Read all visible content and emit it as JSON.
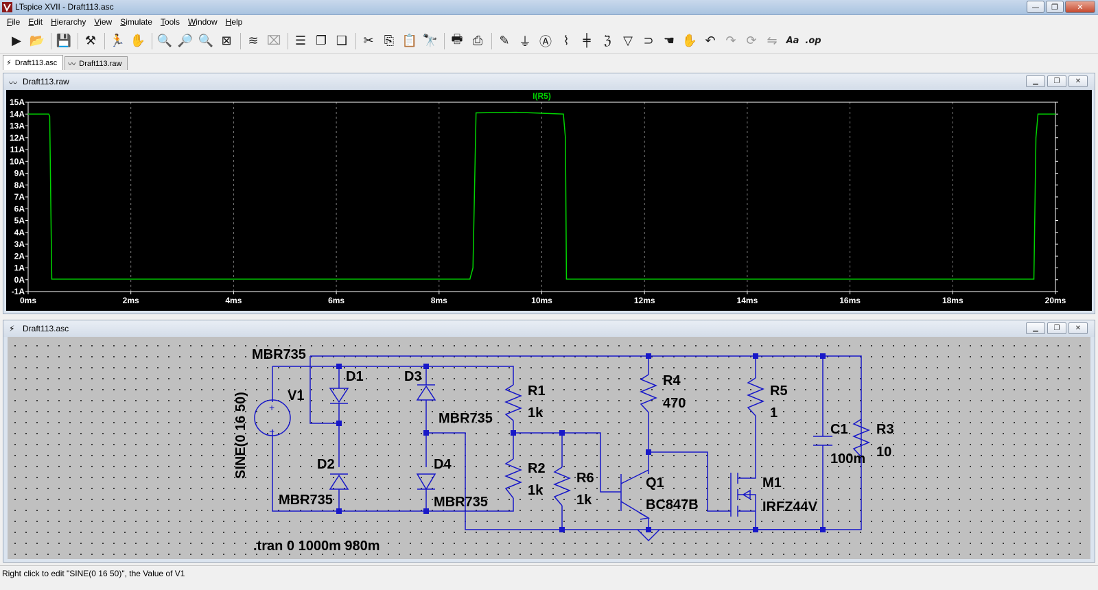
{
  "window": {
    "title": "LTspice XVII - Draft113.asc"
  },
  "menu": [
    {
      "label": "File",
      "accel": "F",
      "rest": "ile"
    },
    {
      "label": "Edit",
      "accel": "E",
      "rest": "dit"
    },
    {
      "label": "Hierarchy",
      "accel": "H",
      "rest": "ierarchy"
    },
    {
      "label": "View",
      "accel": "V",
      "rest": "iew"
    },
    {
      "label": "Simulate",
      "accel": "S",
      "rest": "imulate"
    },
    {
      "label": "Tools",
      "accel": "T",
      "rest": "ools"
    },
    {
      "label": "Window",
      "accel": "W",
      "rest": "indow"
    },
    {
      "label": "Help",
      "accel": "H",
      "rest": "elp"
    }
  ],
  "toolbar": [
    {
      "name": "run-icon",
      "glyph": "▶",
      "enabled": true
    },
    {
      "name": "open-icon",
      "glyph": "📂",
      "enabled": true
    },
    {
      "sep": true
    },
    {
      "name": "save-icon",
      "glyph": "💾",
      "enabled": true
    },
    {
      "sep": true
    },
    {
      "name": "control-panel-icon",
      "glyph": "⚒",
      "enabled": true
    },
    {
      "sep": true
    },
    {
      "name": "halt-icon",
      "glyph": "🏃",
      "enabled": true
    },
    {
      "name": "pan-icon",
      "glyph": "✋",
      "enabled": false
    },
    {
      "sep": true
    },
    {
      "name": "zoom-in-icon",
      "glyph": "🔍",
      "enabled": true
    },
    {
      "name": "zoom-area-icon",
      "glyph": "🔎",
      "enabled": false
    },
    {
      "name": "zoom-out-icon",
      "glyph": "🔍",
      "enabled": true
    },
    {
      "name": "zoom-fit-icon",
      "glyph": "⊠",
      "enabled": true
    },
    {
      "sep": true
    },
    {
      "name": "autoscale-icon",
      "glyph": "≋",
      "enabled": true
    },
    {
      "name": "delete-trace-icon",
      "glyph": "⌧",
      "enabled": false
    },
    {
      "sep": true
    },
    {
      "name": "tile-horizontal-icon",
      "glyph": "☰",
      "enabled": true
    },
    {
      "name": "cascade-icon",
      "glyph": "❐",
      "enabled": true
    },
    {
      "name": "tile-vertical-icon",
      "glyph": "❑",
      "enabled": true
    },
    {
      "sep": true
    },
    {
      "name": "cut-icon",
      "glyph": "✂",
      "enabled": true
    },
    {
      "name": "copy-icon",
      "glyph": "⎘",
      "enabled": true
    },
    {
      "name": "paste-icon",
      "glyph": "📋",
      "enabled": false
    },
    {
      "name": "find-icon",
      "glyph": "🔭",
      "enabled": true
    },
    {
      "sep": true
    },
    {
      "name": "print-preview-icon",
      "glyph": "🖶",
      "enabled": true
    },
    {
      "name": "print-icon",
      "glyph": "⎙",
      "enabled": true
    },
    {
      "sep": true
    },
    {
      "name": "draw-wire-icon",
      "glyph": "✎",
      "enabled": true
    },
    {
      "name": "ground-icon",
      "glyph": "⏚",
      "enabled": true
    },
    {
      "name": "label-net-icon",
      "glyph": "Ⓐ",
      "enabled": true
    },
    {
      "name": "resistor-icon",
      "glyph": "⌇",
      "enabled": true
    },
    {
      "name": "capacitor-icon",
      "glyph": "╪",
      "enabled": true
    },
    {
      "name": "inductor-icon",
      "glyph": "ℨ",
      "enabled": true
    },
    {
      "name": "diode-icon",
      "glyph": "▽",
      "enabled": true
    },
    {
      "name": "component-icon",
      "glyph": "⊃",
      "enabled": true
    },
    {
      "name": "move-icon",
      "glyph": "☚",
      "enabled": true
    },
    {
      "name": "drag-icon",
      "glyph": "✋",
      "enabled": true
    },
    {
      "name": "undo-icon",
      "glyph": "↶",
      "enabled": true
    },
    {
      "name": "redo-icon",
      "glyph": "↷",
      "enabled": false
    },
    {
      "name": "rotate-icon",
      "glyph": "⟳",
      "enabled": false
    },
    {
      "name": "mirror-icon",
      "glyph": "⇋",
      "enabled": false
    },
    {
      "name": "text-icon",
      "glyph": "Aa",
      "enabled": true
    },
    {
      "name": "spice-directive-icon",
      "glyph": ".op",
      "enabled": true
    }
  ],
  "tabs": [
    {
      "label": "Draft113.asc",
      "icon": "⚡",
      "active": true
    },
    {
      "label": "Draft113.raw",
      "icon": "〰",
      "active": false
    }
  ],
  "waveform": {
    "title": "Draft113.raw",
    "trace_name": "I(R5)",
    "colors": {
      "trace": "#00d400",
      "grid": "#7a7a7a",
      "axis": "#ffffff",
      "label": "#ffffff"
    }
  },
  "chart_data": {
    "type": "line",
    "title": "",
    "xlabel": "",
    "ylabel": "",
    "xlim": [
      0,
      20
    ],
    "ylim": [
      -1,
      15
    ],
    "x_ticks": [
      "0ms",
      "2ms",
      "4ms",
      "6ms",
      "8ms",
      "10ms",
      "12ms",
      "14ms",
      "16ms",
      "18ms",
      "20ms"
    ],
    "y_ticks": [
      "15A",
      "14A",
      "13A",
      "12A",
      "11A",
      "10A",
      "9A",
      "8A",
      "7A",
      "6A",
      "5A",
      "4A",
      "3A",
      "2A",
      "1A",
      "0A",
      "-1A"
    ],
    "grid": true,
    "series": [
      {
        "name": "I(R5)",
        "color": "#00d400",
        "x": [
          0,
          0.4,
          0.42,
          0.46,
          8.6,
          8.66,
          8.72,
          9.5,
          10.42,
          10.46,
          10.48,
          19.58,
          19.62,
          19.66,
          20
        ],
        "y": [
          14.0,
          14.0,
          13.8,
          0.05,
          0.05,
          1.0,
          14.1,
          14.15,
          14.0,
          12.0,
          0.05,
          0.05,
          12.0,
          14.0,
          14.0
        ]
      }
    ]
  },
  "schematic": {
    "title": "Draft113.asc",
    "labels": {
      "d1_model": "MBR735",
      "v1_name": "V1",
      "v1_value": "SINE(0 16 50)",
      "d1": "D1",
      "d2": "D2",
      "d2_model": "MBR735",
      "d3": "D3",
      "d3_model": "MBR735",
      "d4": "D4",
      "d4_model": "MBR735",
      "r1": "R1",
      "r1_value": "1k",
      "r2": "R2",
      "r2_value": "1k",
      "r6": "R6",
      "r6_value": "1k",
      "r4": "R4",
      "r4_value": "470",
      "q1": "Q1",
      "q1_model": "BC847B",
      "r5": "R5",
      "r5_value": "1",
      "m1": "M1",
      "m1_model": "IRFZ44V",
      "c1": "C1",
      "c1_value": "100m",
      "r3": "R3",
      "r3_value": "10",
      "directive": ".tran 0 1000m 980m"
    },
    "colors": {
      "wire": "#1818c8",
      "text": "#000000",
      "background": "#c0c0c0"
    }
  },
  "status": {
    "text": "Right click to edit \"SINE(0 16 50)\", the Value of V1"
  }
}
